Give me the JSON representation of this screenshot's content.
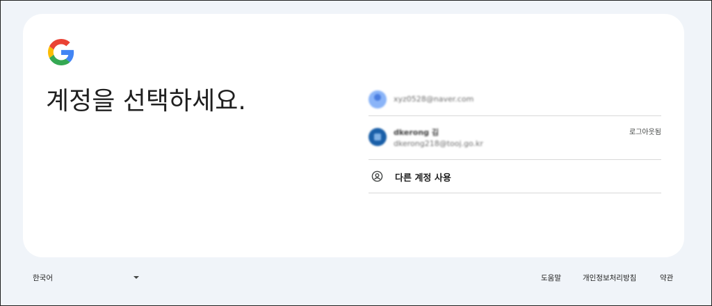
{
  "heading": "계정을 선택하세요.",
  "accounts": [
    {
      "email": "xyz0528@naver.com",
      "status": ""
    },
    {
      "name": "dkerong 김",
      "email": "dkerong218@tooj.go.kr",
      "status": "로그아웃됨"
    }
  ],
  "other_account_label": "다른 계정 사용",
  "footer": {
    "language": "한국어",
    "help": "도움말",
    "privacy": "개인정보처리방침",
    "terms": "약관"
  },
  "colors": {
    "page_bg": "#f0f4f9",
    "card_bg": "#ffffff",
    "divider": "#d8d8d8"
  },
  "icons": [
    "google-logo",
    "account-circle-icon",
    "dropdown-arrow-icon"
  ]
}
